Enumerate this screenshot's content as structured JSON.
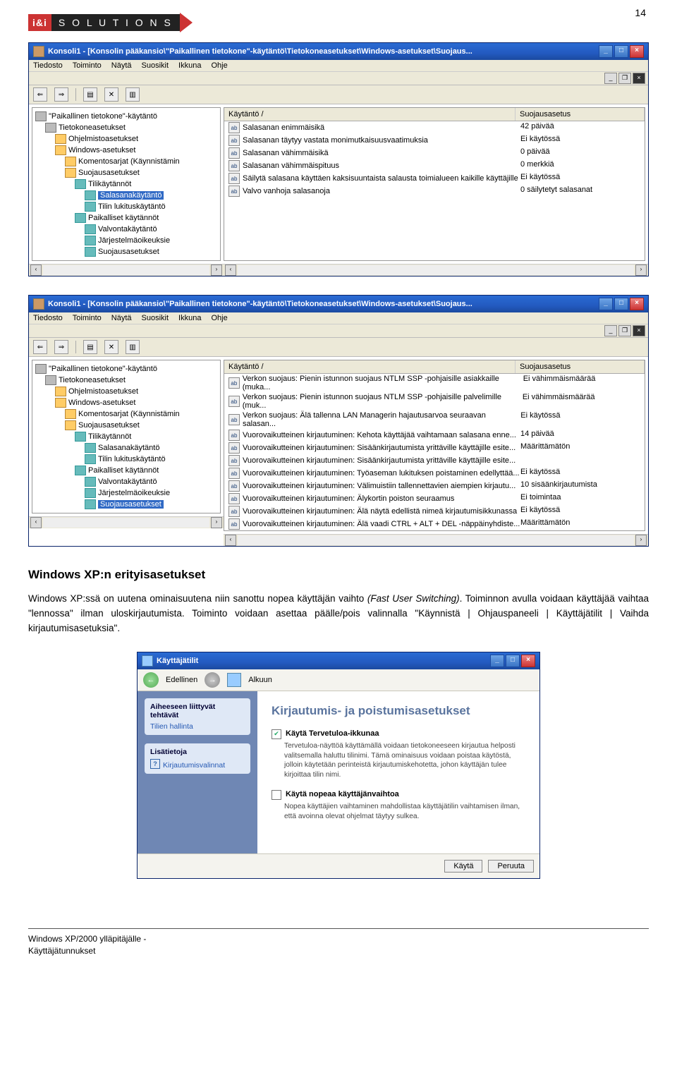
{
  "page_number": "14",
  "logo": {
    "brand1": "i&i",
    "brand2": "S O L U T I O N S"
  },
  "win1": {
    "title": "Konsoli1 - [Konsolin pääkansio\\\"Paikallinen tietokone\"-käytäntö\\Tietokoneasetukset\\Windows-asetukset\\Suojaus...",
    "menu": [
      "Tiedosto",
      "Toiminto",
      "Näytä",
      "Suosikit",
      "Ikkuna",
      "Ohje"
    ],
    "tree": [
      {
        "lvl": 0,
        "icon": "comp",
        "label": "\"Paikallinen tietokone\"-käytäntö"
      },
      {
        "lvl": 1,
        "icon": "comp",
        "label": "Tietokoneasetukset"
      },
      {
        "lvl": 2,
        "icon": "node",
        "label": "Ohjelmistoasetukset"
      },
      {
        "lvl": 2,
        "icon": "node",
        "label": "Windows-asetukset"
      },
      {
        "lvl": 3,
        "icon": "node",
        "label": "Komentosarjat (Käynnistämin"
      },
      {
        "lvl": 3,
        "icon": "node",
        "label": "Suojausasetukset"
      },
      {
        "lvl": 4,
        "icon": "book",
        "label": "Tilikäytännöt"
      },
      {
        "lvl": 5,
        "icon": "book",
        "label": "Salasanakäytäntö",
        "sel": true
      },
      {
        "lvl": 5,
        "icon": "book",
        "label": "Tilin lukituskäytäntö"
      },
      {
        "lvl": 4,
        "icon": "book",
        "label": "Paikalliset käytännöt"
      },
      {
        "lvl": 5,
        "icon": "book",
        "label": "Valvontakäytäntö"
      },
      {
        "lvl": 5,
        "icon": "book",
        "label": "Järjestelmäoikeuksie"
      },
      {
        "lvl": 5,
        "icon": "book",
        "label": "Suojausasetukset"
      }
    ],
    "list_head": [
      "Käytäntö  /",
      "Suojausasetus"
    ],
    "list": [
      {
        "p": "Salasanan enimmäisikä",
        "v": "42 päivää"
      },
      {
        "p": "Salasanan täytyy vastata monimutkaisuusvaatimuksia",
        "v": "Ei käytössä"
      },
      {
        "p": "Salasanan vähimmäisikä",
        "v": "0 päivää"
      },
      {
        "p": "Salasanan vähimmäispituus",
        "v": "0 merkkiä"
      },
      {
        "p": "Säilytä salasana käyttäen kaksisuuntaista salausta toimialueen kaikille käyttäjille",
        "v": "Ei käytössä"
      },
      {
        "p": "Valvo vanhoja salasanoja",
        "v": "0 säilytetyt salasanat"
      }
    ]
  },
  "win2": {
    "title": "Konsoli1 - [Konsolin pääkansio\\\"Paikallinen tietokone\"-käytäntö\\Tietokoneasetukset\\Windows-asetukset\\Suojaus...",
    "menu": [
      "Tiedosto",
      "Toiminto",
      "Näytä",
      "Suosikit",
      "Ikkuna",
      "Ohje"
    ],
    "tree": [
      {
        "lvl": 0,
        "icon": "comp",
        "label": "\"Paikallinen tietokone\"-käytäntö"
      },
      {
        "lvl": 1,
        "icon": "comp",
        "label": "Tietokoneasetukset"
      },
      {
        "lvl": 2,
        "icon": "node",
        "label": "Ohjelmistoasetukset"
      },
      {
        "lvl": 2,
        "icon": "node",
        "label": "Windows-asetukset"
      },
      {
        "lvl": 3,
        "icon": "node",
        "label": "Komentosarjat (Käynnistämin"
      },
      {
        "lvl": 3,
        "icon": "node",
        "label": "Suojausasetukset"
      },
      {
        "lvl": 4,
        "icon": "book",
        "label": "Tilikäytännöt"
      },
      {
        "lvl": 5,
        "icon": "book",
        "label": "Salasanakäytäntö"
      },
      {
        "lvl": 5,
        "icon": "book",
        "label": "Tilin lukituskäytäntö"
      },
      {
        "lvl": 4,
        "icon": "book",
        "label": "Paikalliset käytännöt"
      },
      {
        "lvl": 5,
        "icon": "book",
        "label": "Valvontakäytäntö"
      },
      {
        "lvl": 5,
        "icon": "book",
        "label": "Järjestelmäoikeuksie"
      },
      {
        "lvl": 5,
        "icon": "book",
        "label": "Suojausasetukset",
        "sel": true
      }
    ],
    "list_head": [
      "Käytäntö  /",
      "Suojausasetus"
    ],
    "list": [
      {
        "p": "Verkon suojaus: Pienin istunnon suojaus NTLM SSP -pohjaisille asiakkaille (muka...",
        "v": "Ei vähimmäismäärää"
      },
      {
        "p": "Verkon suojaus: Pienin istunnon suojaus NTLM SSP -pohjaisille palvelimille (muk...",
        "v": "Ei vähimmäismäärää"
      },
      {
        "p": "Verkon suojaus: Älä tallenna LAN Managerin hajautusarvoa seuraavan salasan...",
        "v": "Ei käytössä"
      },
      {
        "p": "Vuorovaikutteinen kirjautuminen: Kehota käyttäjää vaihtamaan salasana enne...",
        "v": "14 päivää"
      },
      {
        "p": "Vuorovaikutteinen kirjautuminen: Sisäänkirjautumista yrittäville käyttäjille esite...",
        "v": "Määrittämätön"
      },
      {
        "p": "Vuorovaikutteinen kirjautuminen: Sisäänkirjautumista yrittäville käyttäjille esite...",
        "v": ""
      },
      {
        "p": "Vuorovaikutteinen kirjautuminen: Työaseman lukituksen poistaminen edellyttää...",
        "v": "Ei käytössä"
      },
      {
        "p": "Vuorovaikutteinen kirjautuminen: Välimuistiin tallennettavien aiempien kirjautu...",
        "v": "10 sisäänkirjautumista"
      },
      {
        "p": "Vuorovaikutteinen kirjautuminen: Älykortin poiston seuraamus",
        "v": "Ei toimintaa"
      },
      {
        "p": "Vuorovaikutteinen kirjautuminen: Älä näytä edellistä nimeä kirjautumisikkunassa",
        "v": "Ei käytössä"
      },
      {
        "p": "Vuorovaikutteinen kirjautuminen: Älä vaadi CTRL + ALT + DEL -näppäinyhdiste...",
        "v": "Määrittämätön"
      }
    ]
  },
  "article": {
    "heading": "Windows XP:n erityisasetukset",
    "body_before_italic": "Windows XP:ssä on uutena ominaisuutena niin sanottu nopea käyttäjän vaihto ",
    "italic": "(Fast User Switching)",
    "body_after_italic": ". Toiminnon avulla voidaan käyttäjää vaihtaa \"lennossa\" ilman uloskirjautumista. Toiminto voidaan asettaa päälle/pois valinnalla \"Käynnistä | Ohjauspaneeli | Käyttäjätilit | Vaihda kirjautumisasetuksia\"."
  },
  "ua": {
    "title": "Käyttäjätilit",
    "nav": {
      "back": "Edellinen",
      "home": "Alkuun"
    },
    "side1": {
      "head": "Aiheeseen liittyvät tehtävät",
      "item": "Tilien hallinta"
    },
    "side2": {
      "head": "Lisätietoja",
      "item": "Kirjautumisvalinnat"
    },
    "main_heading": "Kirjautumis- ja poistumisasetukset",
    "cb1": {
      "label": "Käytä Tervetuloa-ikkunaa",
      "checked": true,
      "desc": "Tervetuloa-näyttöä käyttämällä voidaan tietokoneeseen kirjautua helposti valitsemalla haluttu tilinimi. Tämä ominaisuus voidaan poistaa käytöstä, jolloin käytetään perinteistä kirjautumiskehotetta, johon käyttäjän tulee kirjoittaa tilin nimi."
    },
    "cb2": {
      "label": "Käytä nopeaa käyttäjänvaihtoa",
      "checked": false,
      "desc": "Nopea käyttäjien vaihtaminen mahdollistaa käyttäjätilin vaihtamisen ilman, että avoinna olevat ohjelmat täytyy sulkea."
    },
    "buttons": {
      "apply": "Käytä",
      "cancel": "Peruuta"
    }
  },
  "footer": {
    "line1": "Windows XP/2000 ylläpitäjälle -",
    "line2": "Käyttäjätunnukset"
  }
}
